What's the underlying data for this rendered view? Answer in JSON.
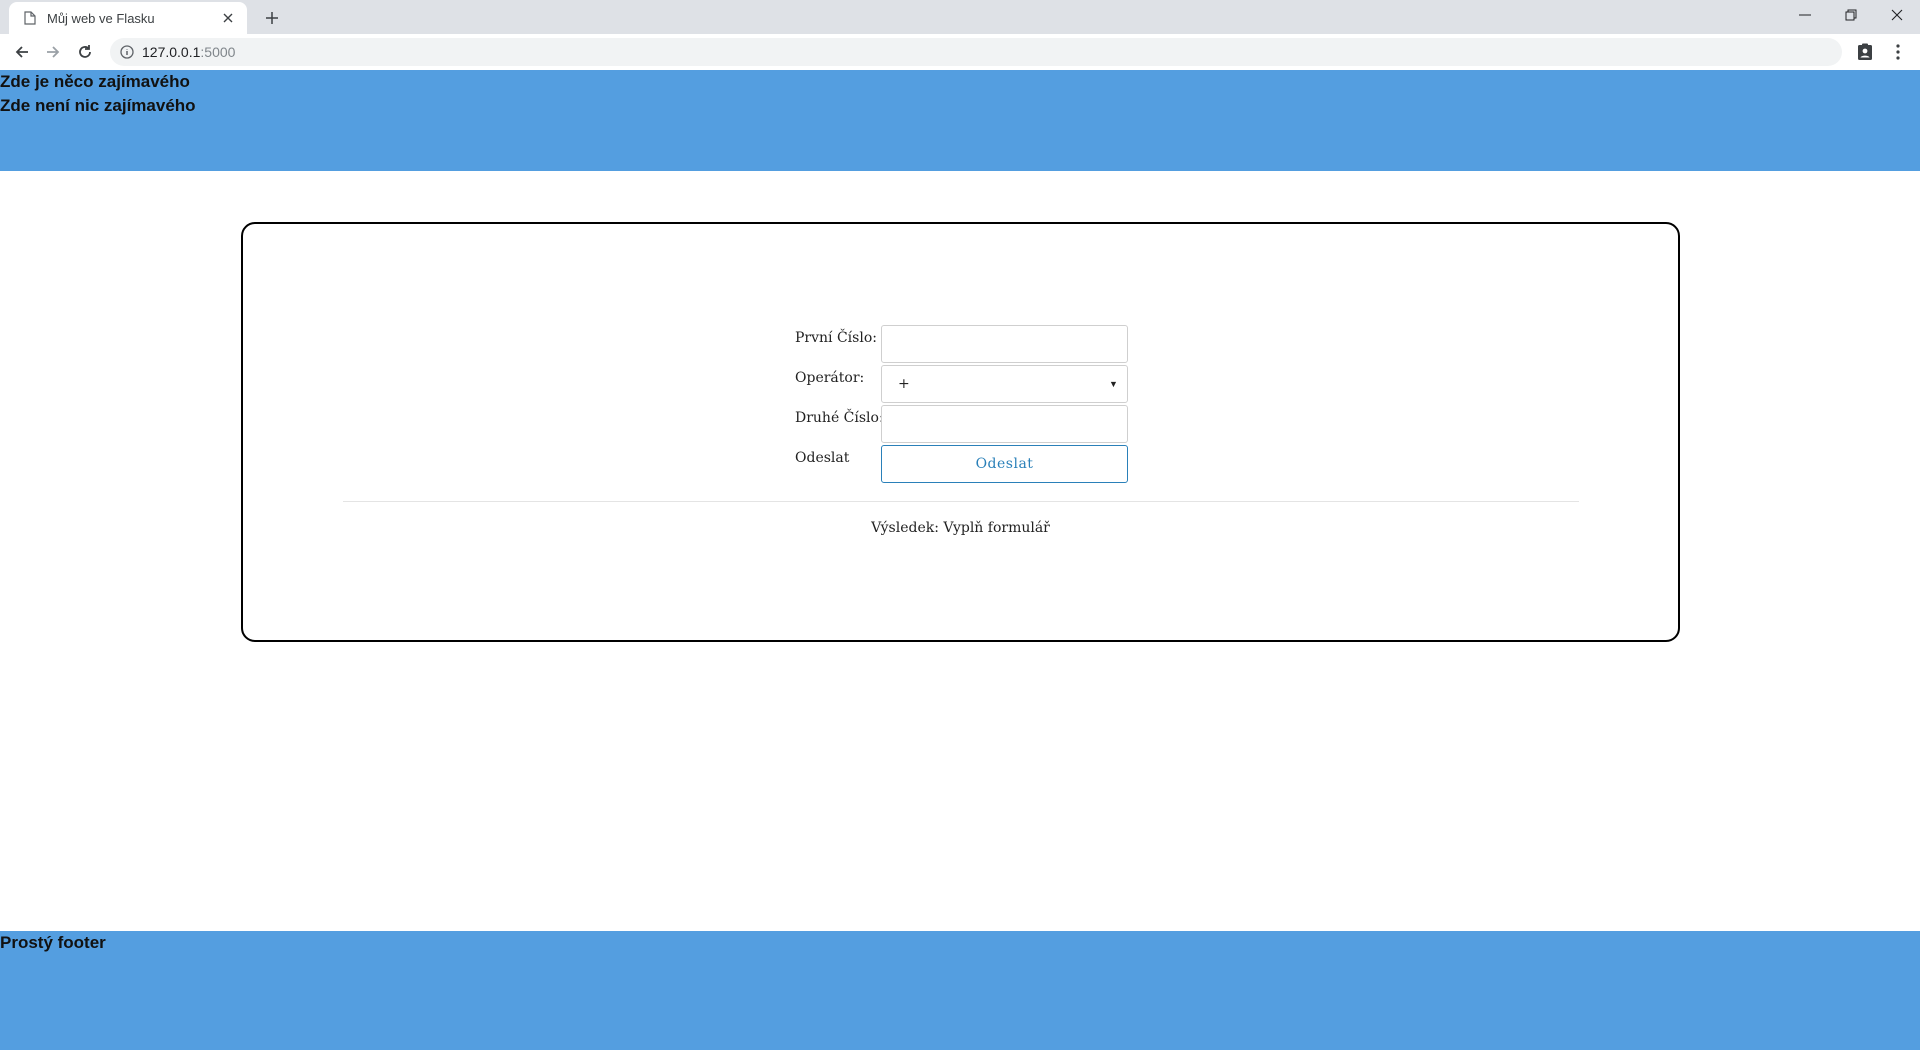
{
  "browser": {
    "tab_title": "Můj web ve Flasku",
    "url_host": "127.0.0.1",
    "url_port": ":5000"
  },
  "header": {
    "line1": "Zde je něco zajímavého",
    "line2": "Zde není nic zajímavého"
  },
  "form": {
    "first_label": "První Číslo:",
    "first_value": "",
    "operator_label": "Operátor:",
    "operator_value": "+",
    "second_label": "Druhé Číslo:",
    "second_value": "",
    "submit_label": "Odeslat",
    "submit_button": "Odeslat"
  },
  "result": {
    "text": "Výsledek: Vyplň formulář"
  },
  "footer": {
    "text": "Prostý footer"
  },
  "colors": {
    "header_bg": "#549ee0",
    "footer_bg": "#549ee0",
    "button_accent": "#2a80b9"
  }
}
